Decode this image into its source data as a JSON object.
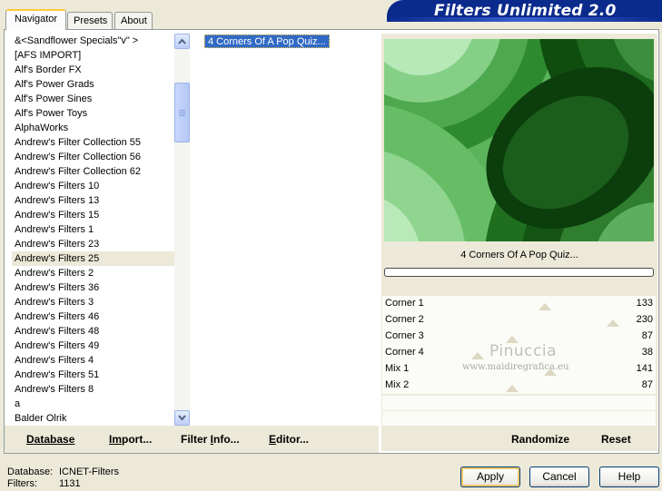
{
  "tabs": [
    {
      "label": "Navigator",
      "active": true
    },
    {
      "label": "Presets",
      "active": false
    },
    {
      "label": "About",
      "active": false
    }
  ],
  "banner": {
    "title": "Filters Unlimited 2.0",
    "color": "#0a2a8c"
  },
  "categories": {
    "items": [
      "&<Sandflower Specials\"v\" >",
      "[AFS IMPORT]",
      "Alf's Border FX",
      "Alf's Power Grads",
      "Alf's Power Sines",
      "Alf's Power Toys",
      "AlphaWorks",
      "Andrew's Filter Collection 55",
      "Andrew's Filter Collection 56",
      "Andrew's Filter Collection 62",
      "Andrew's Filters 10",
      "Andrew's Filters 13",
      "Andrew's Filters 15",
      "Andrew's Filters 1",
      "Andrew's Filters 23",
      "Andrew's Filters 25",
      "Andrew's Filters 2",
      "Andrew's Filters 36",
      "Andrew's Filters 3",
      "Andrew's Filters 46",
      "Andrew's Filters 48",
      "Andrew's Filters 49",
      "Andrew's Filters 4",
      "Andrew's Filters 51",
      "Andrew's Filters 8",
      "a",
      "Balder Olrik"
    ],
    "selected": "Andrew's Filters 25"
  },
  "filters": {
    "items": [
      "4 Corners Of A Pop Quiz..."
    ],
    "selected": "4 Corners Of A Pop Quiz..."
  },
  "preview": {
    "filter_name": "4 Corners Of A Pop Quiz..."
  },
  "sliders": [
    {
      "label": "Corner 1",
      "value": "133",
      "level": 133
    },
    {
      "label": "Corner 2",
      "value": "230",
      "level": 230
    },
    {
      "label": "Corner 3",
      "value": "87",
      "level": 87
    },
    {
      "label": "Corner 4",
      "value": "38",
      "level": 38
    },
    {
      "label": "Mix 1",
      "value": "141",
      "level": 141
    },
    {
      "label": "Mix 2",
      "value": "87",
      "level": 87
    }
  ],
  "toolbar": {
    "database": {
      "u": "D",
      "rest": "atabase"
    },
    "import": {
      "pre": "I",
      "u": "m",
      "rest": "port..."
    },
    "filter_info": {
      "pre": "Filter ",
      "u": "I",
      "rest": "nfo..."
    },
    "editor": {
      "u": "E",
      "rest": "ditor..."
    },
    "randomize": "Randomize",
    "reset": "Reset"
  },
  "status": {
    "database_label": "Database:",
    "database_value": "ICNET-Filters",
    "filters_label": "Filters:",
    "filters_value": "1131"
  },
  "dialog": {
    "apply": "Apply",
    "cancel": "Cancel",
    "help": "Help"
  },
  "watermark": {
    "title": "Pinuccia",
    "url": "www.maidiregrafica.eu"
  }
}
